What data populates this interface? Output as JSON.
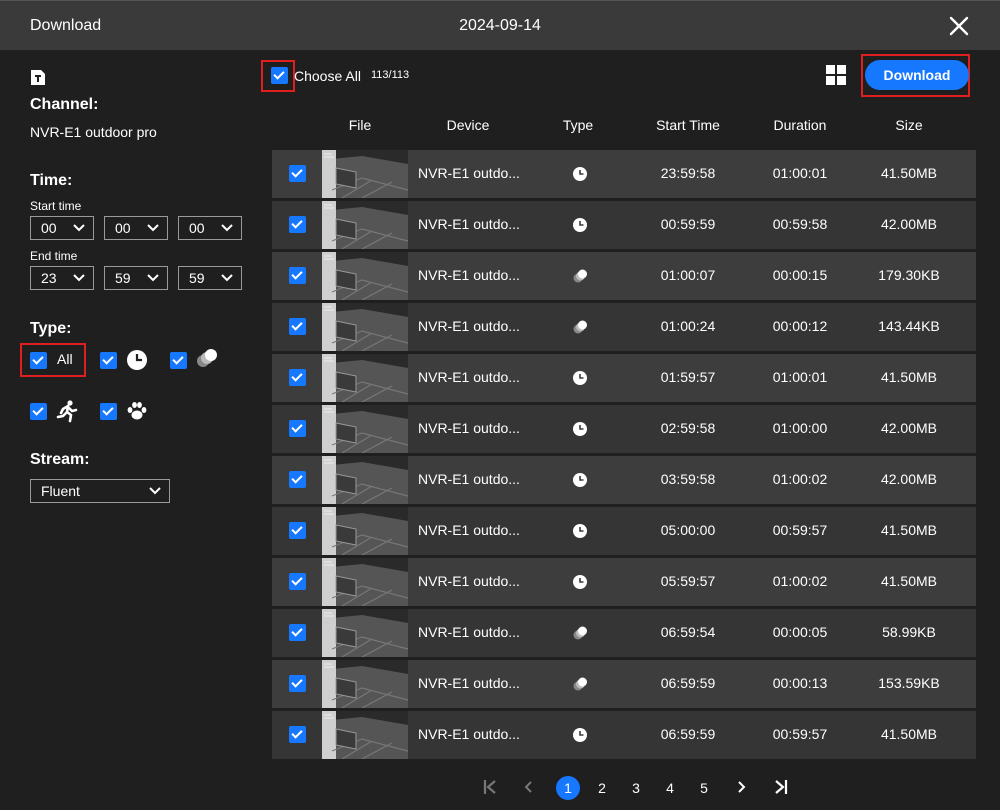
{
  "window": {
    "title": "Download",
    "date": "2024-09-14"
  },
  "sidebar": {
    "channel_label": "Channel:",
    "channel_value": "NVR-E1 outdoor pro",
    "time_label": "Time:",
    "start_label": "Start time",
    "start": {
      "hour": "00",
      "minute": "00",
      "second": "00"
    },
    "end_label": "End time",
    "end": {
      "hour": "23",
      "minute": "59",
      "second": "59"
    },
    "type_label": "Type:",
    "type_all_label": "All",
    "stream_label": "Stream:",
    "stream_value": "Fluent"
  },
  "toolbar": {
    "choose_all_label": "Choose All",
    "choose_count": "113/113",
    "download_label": "Download"
  },
  "table": {
    "headers": {
      "file": "File",
      "device": "Device",
      "type": "Type",
      "start": "Start Time",
      "duration": "Duration",
      "size": "Size"
    },
    "rows": [
      {
        "device": "NVR-E1 outdo...",
        "type": "timer",
        "start": "23:59:58",
        "duration": "01:00:01",
        "size": "41.50MB"
      },
      {
        "device": "NVR-E1 outdo...",
        "type": "timer",
        "start": "00:59:59",
        "duration": "00:59:58",
        "size": "42.00MB"
      },
      {
        "device": "NVR-E1 outdo...",
        "type": "motion",
        "start": "01:00:07",
        "duration": "00:00:15",
        "size": "179.30KB"
      },
      {
        "device": "NVR-E1 outdo...",
        "type": "motion",
        "start": "01:00:24",
        "duration": "00:00:12",
        "size": "143.44KB"
      },
      {
        "device": "NVR-E1 outdo...",
        "type": "timer",
        "start": "01:59:57",
        "duration": "01:00:01",
        "size": "41.50MB"
      },
      {
        "device": "NVR-E1 outdo...",
        "type": "timer",
        "start": "02:59:58",
        "duration": "01:00:00",
        "size": "42.00MB"
      },
      {
        "device": "NVR-E1 outdo...",
        "type": "timer",
        "start": "03:59:58",
        "duration": "01:00:02",
        "size": "42.00MB"
      },
      {
        "device": "NVR-E1 outdo...",
        "type": "timer",
        "start": "05:00:00",
        "duration": "00:59:57",
        "size": "41.50MB"
      },
      {
        "device": "NVR-E1 outdo...",
        "type": "timer",
        "start": "05:59:57",
        "duration": "01:00:02",
        "size": "41.50MB"
      },
      {
        "device": "NVR-E1 outdo...",
        "type": "motion",
        "start": "06:59:54",
        "duration": "00:00:05",
        "size": "58.99KB"
      },
      {
        "device": "NVR-E1 outdo...",
        "type": "motion",
        "start": "06:59:59",
        "duration": "00:00:13",
        "size": "153.59KB"
      },
      {
        "device": "NVR-E1 outdo...",
        "type": "timer",
        "start": "06:59:59",
        "duration": "00:59:57",
        "size": "41.50MB"
      }
    ]
  },
  "pagination": {
    "pages": [
      "1",
      "2",
      "3",
      "4",
      "5"
    ],
    "current": "1"
  },
  "colors": {
    "accent": "#1677ff",
    "highlight": "#e02020",
    "background": "#1f1f1f",
    "titlebar": "#3a3a3a"
  }
}
